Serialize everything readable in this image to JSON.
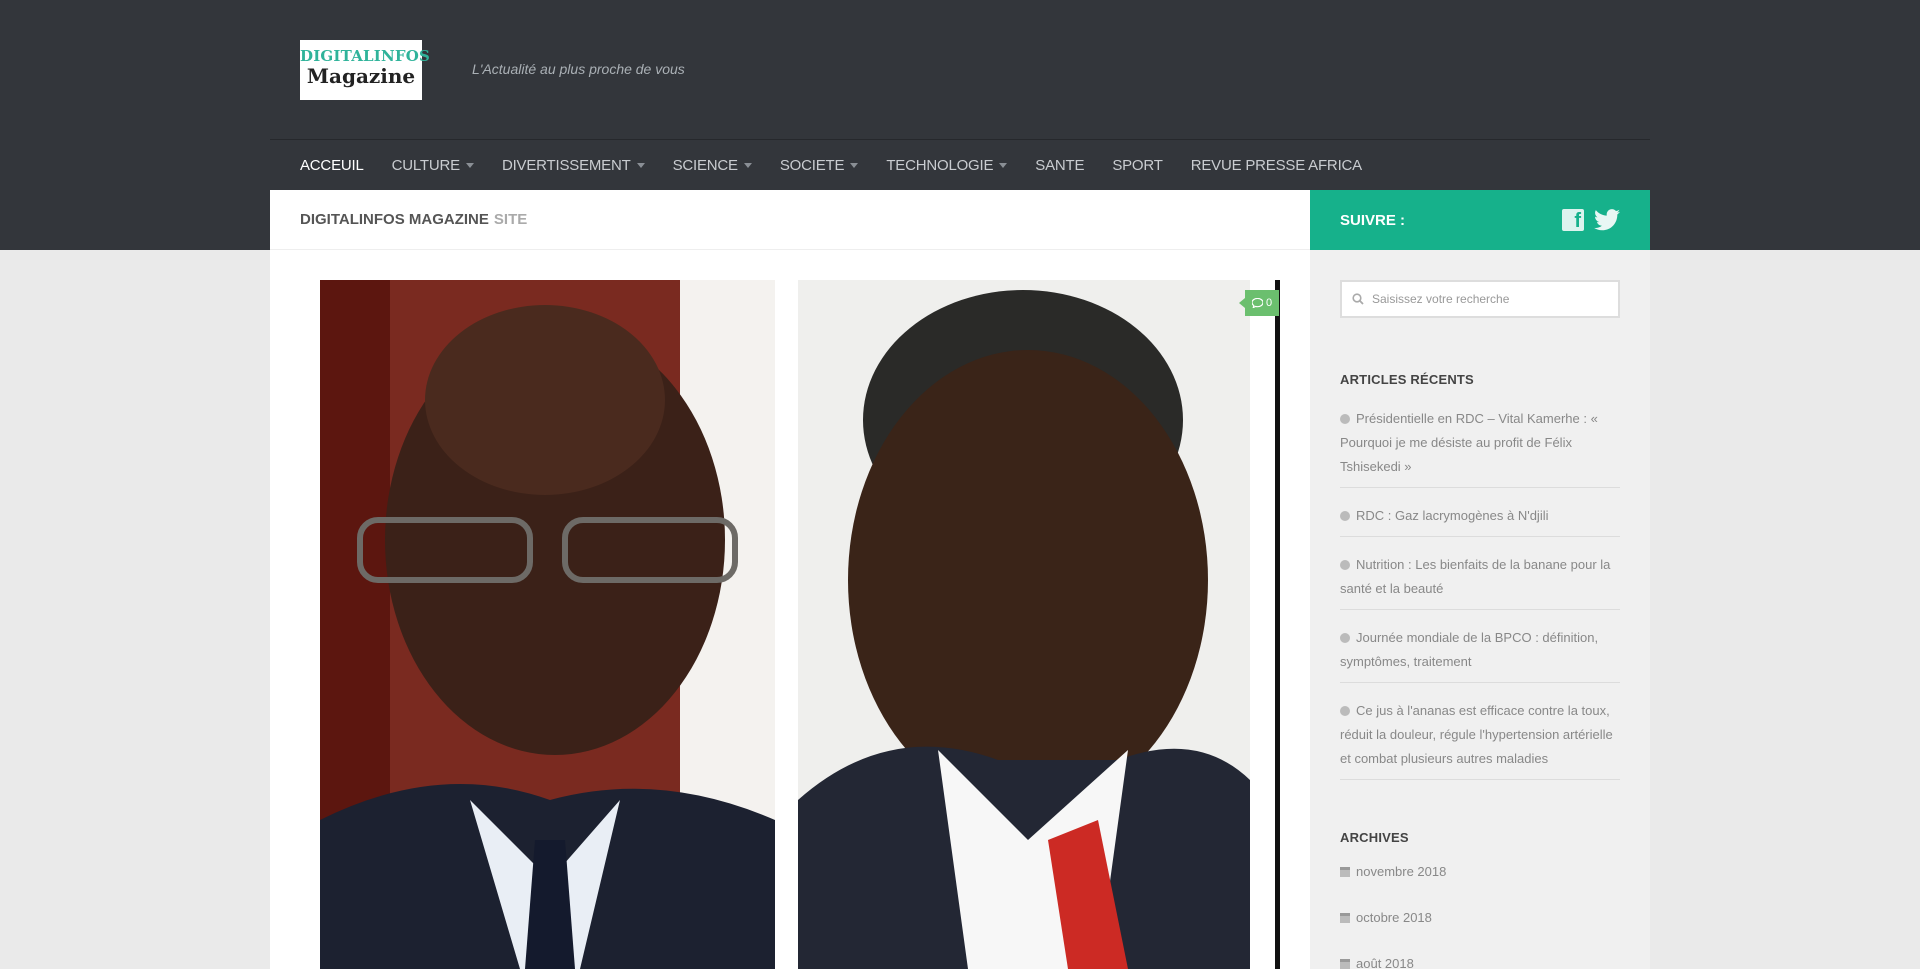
{
  "header": {
    "logo_line1": "DIGITALINFOS",
    "logo_line2": "Magazine",
    "tagline": "L'Actualité au plus proche de vous"
  },
  "nav": {
    "items": [
      {
        "label": "ACCEUIL",
        "active": true,
        "dropdown": false
      },
      {
        "label": "CULTURE",
        "active": false,
        "dropdown": true
      },
      {
        "label": "DIVERTISSEMENT",
        "active": false,
        "dropdown": true
      },
      {
        "label": "SCIENCE",
        "active": false,
        "dropdown": true
      },
      {
        "label": "SOCIETE",
        "active": false,
        "dropdown": true
      },
      {
        "label": "TECHNOLOGIE",
        "active": false,
        "dropdown": true
      },
      {
        "label": "SANTE",
        "active": false,
        "dropdown": false
      },
      {
        "label": "SPORT",
        "active": false,
        "dropdown": false
      },
      {
        "label": "REVUE PRESSE AFRICA",
        "active": false,
        "dropdown": false
      }
    ]
  },
  "breadcrumb": {
    "main": "DIGITALINFOS MAGAZINE",
    "sub": "SITE"
  },
  "follow": {
    "label": "SUIVRE :",
    "icons": [
      "facebook-icon",
      "twitter-icon"
    ]
  },
  "post": {
    "comment_count": "0"
  },
  "sidebar": {
    "search_placeholder": "Saisissez votre recherche",
    "recent_title": "ARTICLES RÉCENTS",
    "recent_posts": [
      "Présidentielle en RDC – Vital Kamerhe : « Pourquoi je me désiste au profit de Félix Tshisekedi »",
      "RDC : Gaz lacrymogènes à N'djili",
      "Nutrition : Les bienfaits de la banane pour la santé et la beauté",
      "Journée mondiale de la BPCO : définition, symptômes, traitement",
      "Ce jus à l'ananas est efficace contre la toux, réduit la douleur, régule l'hypertension artérielle et combat plusieurs autres maladies"
    ],
    "archives_title": "ARCHIVES",
    "archives": [
      "novembre 2018",
      "octobre 2018",
      "août 2018"
    ]
  },
  "colors": {
    "header_bg": "#33363b",
    "accent": "#16b18b",
    "comment_badge": "#6bbf6e"
  }
}
